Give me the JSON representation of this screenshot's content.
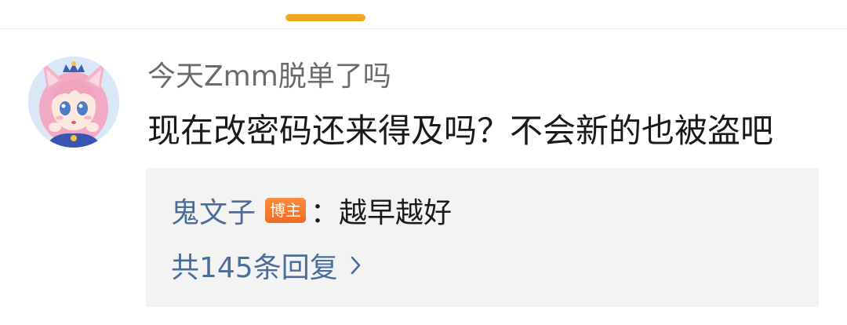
{
  "header": {
    "active_tab_color": "#f5a623"
  },
  "comment": {
    "username": "今天Zmm脱单了吗",
    "text": "现在改密码还来得及吗？不会新的也被盗吧",
    "avatar_icon": "anime-girl-avatar"
  },
  "reply_preview": {
    "author": "鬼文子",
    "badge": "博主",
    "colon": "：",
    "text": "越早越好",
    "more_replies_label": "共145条回复",
    "more_icon": "chevron-right-icon"
  },
  "colors": {
    "link": "#4a6d9c",
    "badge": "#f26b21",
    "reply_box_bg": "#f3f3f3"
  }
}
